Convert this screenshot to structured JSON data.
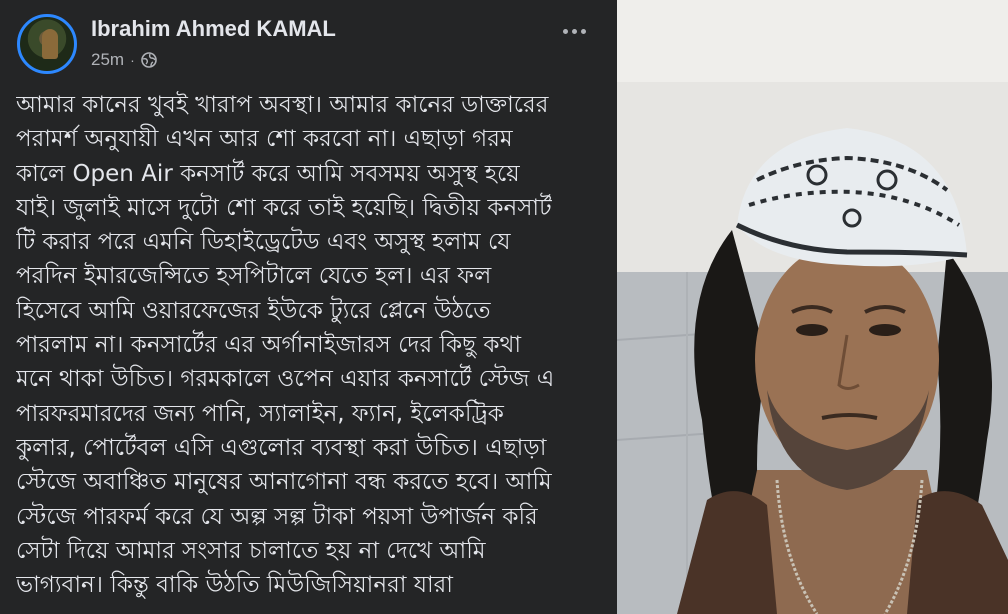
{
  "post": {
    "author": "Ibrahim Ahmed KAMAL",
    "time": "25m",
    "separator": "·",
    "privacy_icon": "globe-icon",
    "more_icon": "more-horizontal-icon",
    "lines": [
      "আমার কানের খুবই খারাপ অবস্থা। আমার কানের ডাক্তারের",
      "পরামর্শ অনুযায়ী এখন আর শো করবো না। এছাড়া গরম",
      "কালে Open Air কনসার্ট করে আমি সবসময় অসুস্থ হয়ে",
      "যাই। জুলাই মাসে দুটো শো করে তাই হয়েছি। দ্বিতীয় কনসার্ট",
      "টি  করার পরে এমনি ডিহাইড্রেটেড এবং অসুস্থ  হলাম যে",
      "পরদিন ইমারজেন্সিতে হসপিটালে যেতে হল।  এর ফল",
      "হিসেবে আমি ওয়ারফেজের ইউকে ট্যুরে প্লেনে উঠতে",
      "পারলাম না। কনসার্টের এর অর্গানাইজারস দের কিছু কথা",
      "মনে থাকা উচিত। গরমকালে ওপেন এয়ার কনসার্টে স্টেজ এ",
      "পারফরমারদের জন্য পানি, স্যালাইন, ফ্যান, ইলেকট্রিক",
      "কুলার, পোর্টেবল এসি এগুলোর ব্যবস্থা করা উচিত। এছাড়া",
      "স্টেজে অবাঞ্চিত মানুষের আনাগোনা বন্ধ করতে হবে। আমি",
      "স্টেজে পারফর্ম করে যে অল্প সল্প টাকা পয়সা উপার্জন করি",
      "সেটা দিয়ে আমার সংসার চালাতে হয় না দেখে আমি",
      "ভাগ্যবান। কিন্তু বাকি উঠতি  মিউজিসিয়ানরা যারা"
    ]
  },
  "colors": {
    "panel_bg": "#242526",
    "text": "#e4e6eb",
    "secondary_text": "#b0b3b8",
    "avatar_ring": "#2d88ff"
  }
}
